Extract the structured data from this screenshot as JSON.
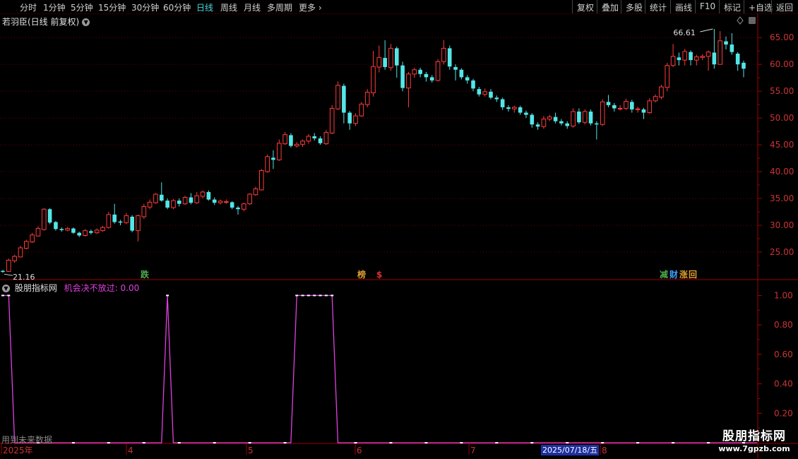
{
  "toolbar": {
    "left_items": [
      "分时",
      "1分钟",
      "5分钟",
      "15分钟",
      "30分钟",
      "60分钟",
      "日线",
      "周线",
      "月线",
      "多周期",
      "更多"
    ],
    "active": "日线",
    "right_items": [
      "复权",
      "叠加",
      "多股",
      "统计",
      "画线",
      "F10",
      "标记",
      "+自选",
      "返回"
    ]
  },
  "header": {
    "title": "若羽臣(日线 前复权)"
  },
  "price_axis": {
    "ticks": [
      "65.00",
      "60.00",
      "55.00",
      "50.00",
      "45.00",
      "40.00",
      "35.00",
      "30.00",
      "25.00"
    ]
  },
  "price_labels": {
    "high": "66.61",
    "low": "21.16"
  },
  "signals": [
    {
      "text": "跌",
      "color": "#4caf50"
    },
    {
      "text": "榜",
      "color": "#e0a030"
    },
    {
      "text": "$",
      "color": "#e03030"
    },
    {
      "text": "减",
      "color": "#4caf50"
    },
    {
      "text": "财",
      "color": "#3aa0ff"
    },
    {
      "text": "涨",
      "color": "#e0a030"
    },
    {
      "text": "回",
      "color": "#e0a030"
    }
  ],
  "indicator": {
    "name": "股朋指标网",
    "label": "机会决不放过: 0.00",
    "axis_ticks": [
      "1.00",
      "0.80",
      "0.60",
      "0.40",
      "0.20"
    ]
  },
  "future_text": "用到未来数据",
  "time_axis": {
    "labels": [
      "2025年",
      "4",
      "5",
      "6",
      "7",
      "8"
    ],
    "highlight": "2025/07/18/五"
  },
  "watermark": {
    "line1": "股朋指标网",
    "line2": "www.7gpzb.com"
  },
  "colors": {
    "up": "#ff3c3c",
    "down": "#54e6e6",
    "indicator": "#e040e0",
    "grid": "#6a0000",
    "active_tab": "#4ad7e0"
  },
  "chart_data": [
    {
      "type": "candlestick",
      "ylim": [
        20,
        67
      ],
      "candles": [
        [
          21.5,
          21.3,
          21.7,
          21.16
        ],
        [
          21.4,
          23.5,
          23.8,
          21.3
        ],
        [
          23.4,
          24.2,
          24.5,
          23.0
        ],
        [
          24.1,
          25.8,
          26.2,
          24.0
        ],
        [
          25.7,
          27.0,
          27.3,
          25.5
        ],
        [
          26.9,
          28.2,
          28.6,
          26.7
        ],
        [
          28.0,
          29.4,
          29.8,
          27.9
        ],
        [
          29.2,
          33.0,
          33.2,
          29.0
        ],
        [
          33.0,
          30.5,
          33.2,
          30.2
        ],
        [
          30.6,
          29.3,
          30.8,
          29.0
        ],
        [
          29.3,
          29.1,
          29.6,
          28.8
        ],
        [
          29.1,
          29.4,
          29.7,
          28.9
        ],
        [
          29.4,
          28.6,
          29.6,
          28.4
        ],
        [
          28.6,
          28.1,
          28.8,
          27.8
        ],
        [
          28.1,
          29.0,
          29.3,
          27.9
        ],
        [
          28.9,
          28.6,
          29.2,
          28.3
        ],
        [
          28.6,
          29.1,
          29.4,
          28.4
        ],
        [
          29.0,
          29.6,
          29.9,
          28.8
        ],
        [
          29.6,
          32.0,
          32.5,
          29.4
        ],
        [
          32.0,
          30.6,
          34.0,
          30.3
        ],
        [
          30.7,
          30.5,
          31.0,
          30.0
        ],
        [
          30.5,
          31.8,
          32.3,
          30.2
        ],
        [
          31.6,
          29.0,
          31.9,
          28.7
        ],
        [
          29.0,
          31.8,
          32.0,
          27.0
        ],
        [
          31.6,
          33.5,
          34.0,
          31.2
        ],
        [
          33.4,
          34.3,
          34.8,
          33.0
        ],
        [
          34.2,
          35.8,
          36.0,
          34.0
        ],
        [
          35.7,
          34.6,
          38.0,
          34.4
        ],
        [
          34.6,
          33.3,
          35.0,
          33.0
        ],
        [
          33.3,
          34.6,
          34.9,
          33.0
        ],
        [
          34.6,
          34.0,
          35.0,
          33.5
        ],
        [
          34.0,
          35.2,
          35.5,
          33.8
        ],
        [
          35.2,
          34.2,
          36.0,
          33.9
        ],
        [
          34.2,
          35.5,
          36.2,
          34.0
        ],
        [
          35.4,
          36.2,
          36.5,
          35.0
        ],
        [
          36.2,
          34.8,
          36.5,
          34.6
        ],
        [
          34.8,
          34.2,
          35.2,
          33.8
        ],
        [
          34.2,
          34.5,
          34.8,
          33.9
        ],
        [
          34.4,
          34.4,
          34.8,
          34.0
        ],
        [
          34.3,
          33.3,
          34.5,
          33.0
        ],
        [
          33.3,
          33.0,
          33.6,
          32.0
        ],
        [
          33.0,
          34.0,
          34.2,
          32.6
        ],
        [
          34.0,
          35.8,
          36.0,
          33.8
        ],
        [
          35.7,
          36.8,
          37.2,
          35.5
        ],
        [
          36.6,
          40.2,
          40.5,
          36.5
        ],
        [
          40.0,
          42.8,
          43.2,
          39.8
        ],
        [
          42.6,
          42.2,
          44.0,
          40.5
        ],
        [
          42.2,
          45.3,
          46.0,
          42.0
        ],
        [
          45.2,
          46.9,
          47.4,
          45.0
        ],
        [
          46.8,
          44.8,
          47.2,
          44.5
        ],
        [
          44.8,
          45.1,
          45.5,
          44.5
        ],
        [
          45.1,
          45.7,
          46.0,
          44.6
        ],
        [
          45.7,
          46.6,
          47.0,
          45.2
        ],
        [
          46.6,
          46.2,
          47.2,
          45.8
        ],
        [
          46.2,
          45.3,
          46.6,
          45.0
        ],
        [
          45.2,
          47.3,
          47.8,
          45.0
        ],
        [
          47.2,
          51.8,
          52.4,
          47.0
        ],
        [
          51.7,
          56.1,
          56.8,
          51.5
        ],
        [
          56.0,
          51.0,
          56.4,
          49.0
        ],
        [
          51.0,
          49.0,
          51.3,
          47.8
        ],
        [
          49.0,
          50.4,
          50.9,
          48.5
        ],
        [
          50.4,
          52.6,
          53.0,
          50.2
        ],
        [
          52.5,
          54.8,
          55.4,
          52.0
        ],
        [
          54.7,
          59.6,
          62.5,
          54.0
        ],
        [
          59.5,
          61.3,
          63.5,
          58.5
        ],
        [
          61.2,
          59.5,
          64.5,
          59.0
        ],
        [
          59.4,
          63.0,
          63.8,
          58.8
        ],
        [
          63.0,
          59.8,
          63.3,
          57.5
        ],
        [
          59.8,
          55.6,
          60.5,
          55.0
        ],
        [
          55.6,
          58.2,
          58.6,
          52.0
        ],
        [
          58.2,
          59.0,
          59.4,
          57.5
        ],
        [
          59.0,
          58.2,
          59.4,
          57.6
        ],
        [
          58.2,
          57.6,
          58.6,
          56.8
        ],
        [
          57.6,
          57.0,
          58.0,
          56.6
        ],
        [
          57.0,
          60.5,
          61.0,
          56.8
        ],
        [
          60.5,
          63.0,
          64.5,
          60.0
        ],
        [
          63.0,
          59.6,
          63.5,
          59.0
        ],
        [
          59.5,
          59.0,
          60.0,
          57.0
        ],
        [
          59.0,
          57.6,
          59.3,
          57.2
        ],
        [
          57.6,
          57.0,
          58.0,
          56.4
        ],
        [
          57.0,
          55.5,
          57.3,
          55.0
        ],
        [
          55.4,
          54.4,
          55.8,
          54.0
        ],
        [
          54.4,
          54.9,
          55.5,
          54.0
        ],
        [
          54.9,
          53.8,
          55.4,
          53.5
        ],
        [
          53.8,
          53.5,
          54.2,
          53.0
        ],
        [
          53.5,
          52.0,
          53.8,
          51.5
        ],
        [
          52.0,
          51.7,
          52.4,
          51.2
        ],
        [
          51.7,
          52.0,
          52.3,
          51.0
        ],
        [
          52.0,
          51.0,
          52.3,
          50.6
        ],
        [
          51.0,
          50.6,
          51.4,
          50.0
        ],
        [
          50.6,
          48.8,
          50.9,
          48.2
        ],
        [
          48.8,
          48.4,
          49.2,
          47.8
        ],
        [
          48.4,
          49.8,
          50.4,
          48.0
        ],
        [
          49.8,
          50.2,
          50.6,
          49.4
        ],
        [
          50.2,
          49.4,
          51.0,
          49.0
        ],
        [
          49.4,
          49.0,
          49.8,
          48.6
        ],
        [
          49.0,
          48.5,
          49.4,
          48.0
        ],
        [
          48.5,
          51.2,
          51.8,
          48.2
        ],
        [
          51.2,
          49.2,
          51.8,
          48.9
        ],
        [
          49.2,
          51.2,
          51.6,
          48.8
        ],
        [
          51.2,
          49.0,
          51.6,
          48.6
        ],
        [
          49.0,
          48.8,
          49.4,
          46.0
        ],
        [
          48.8,
          53.0,
          53.5,
          48.5
        ],
        [
          53.0,
          52.4,
          54.3,
          52.0
        ],
        [
          52.4,
          51.8,
          52.8,
          51.2
        ],
        [
          51.8,
          51.8,
          52.4,
          51.4
        ],
        [
          51.8,
          53.1,
          53.6,
          51.5
        ],
        [
          53.0,
          51.6,
          53.4,
          51.0
        ],
        [
          51.6,
          51.7,
          52.1,
          51.0
        ],
        [
          51.6,
          51.0,
          51.9,
          49.8
        ],
        [
          51.0,
          53.2,
          53.7,
          50.8
        ],
        [
          53.2,
          54.0,
          54.4,
          52.9
        ],
        [
          53.9,
          55.8,
          56.2,
          53.5
        ],
        [
          55.7,
          59.8,
          60.3,
          55.0
        ],
        [
          59.8,
          61.5,
          63.8,
          59.5
        ],
        [
          61.3,
          60.8,
          62.2,
          59.8
        ],
        [
          60.8,
          62.4,
          62.9,
          59.8
        ],
        [
          62.3,
          60.8,
          62.6,
          59.8
        ],
        [
          60.8,
          61.4,
          61.8,
          59.8
        ],
        [
          61.3,
          61.5,
          61.9,
          60.8
        ],
        [
          61.5,
          62.3,
          62.6,
          58.8
        ],
        [
          62.2,
          60.0,
          66.61,
          59.2
        ],
        [
          60.0,
          64.4,
          66.2,
          60.0
        ],
        [
          64.3,
          63.7,
          65.2,
          62.8
        ],
        [
          63.7,
          62.3,
          65.8,
          61.8
        ],
        [
          62.0,
          60.0,
          62.3,
          58.8
        ],
        [
          60.3,
          59.2,
          60.7,
          57.6
        ]
      ]
    },
    {
      "type": "line",
      "name": "机会决不放过",
      "ylim": [
        0,
        1.05
      ],
      "values": [
        1,
        1,
        0,
        0,
        0,
        0,
        0,
        0,
        0,
        0,
        0,
        0,
        0,
        0,
        0,
        0,
        0,
        0,
        0,
        0,
        0,
        0,
        0,
        0,
        0,
        0,
        0,
        0,
        0,
        0,
        0,
        0,
        0,
        0,
        0,
        0,
        0,
        0,
        0,
        0,
        0,
        0,
        0,
        0,
        0,
        0,
        0,
        0,
        0,
        0,
        0,
        0,
        0,
        0,
        0,
        0,
        0,
        0,
        0,
        0,
        0,
        0,
        0,
        0,
        0,
        0,
        0,
        0,
        0,
        0,
        0,
        0,
        0,
        0,
        0,
        0,
        0,
        0,
        0,
        0,
        0,
        0,
        0,
        0,
        0,
        0,
        0,
        0,
        0,
        0,
        0,
        0,
        0,
        0,
        0,
        0,
        0,
        0,
        0,
        0,
        0,
        0,
        0,
        0,
        0,
        0,
        0,
        0,
        0,
        0,
        0,
        0,
        0,
        0,
        0,
        0,
        0,
        0,
        0,
        0,
        0,
        0,
        0,
        0,
        0,
        0,
        0
      ],
      "spikes": [
        [
          0,
          1
        ],
        [
          1,
          1
        ],
        [
          28,
          1
        ],
        [
          50,
          1
        ],
        [
          51,
          1
        ],
        [
          52,
          1
        ],
        [
          53,
          1
        ],
        [
          54,
          1
        ],
        [
          55,
          1
        ],
        [
          56,
          1
        ],
        [
          130,
          1
        ]
      ]
    }
  ]
}
